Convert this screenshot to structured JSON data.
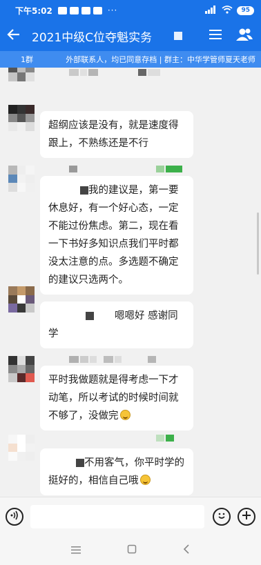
{
  "status_bar": {
    "time": "下午5:02",
    "more": "···",
    "signal": "4G",
    "battery": "95"
  },
  "header": {
    "title": "2021中级C位夺魁实务",
    "back_icon": "arrow-left-icon",
    "menu_icon": "menu-icon",
    "members_icon": "group-members-icon"
  },
  "notice": {
    "left_text": "1群",
    "right_text": "外部联系人，均已同意存档 | 群主：中华学管师夏天老师"
  },
  "messages": [
    {
      "text": "超纲应该是没有，就是速度得跟上，不熟练还是不行"
    },
    {
      "text": "我的建议是，第一要休息好，有一个好心态，一定不能过份焦虑。第二，现在看一下书好多知识点我们平时都没太注意的点。多选题不确定的建议只选两个。"
    },
    {
      "text": "嗯嗯好 感谢同学"
    },
    {
      "text": "平时我做题就是得考虑一下才动笔，所以考试的时候时间就不够了，没做完"
    },
    {
      "text": "不用客气，你平时学的挺好的，相信自己哦"
    }
  ],
  "input_bar": {
    "voice_icon": "voice-icon",
    "emoji_icon": "emoji-icon",
    "plus_icon": "plus-icon",
    "placeholder": ""
  },
  "nav_bar": {
    "menu_icon": "nav-menu-icon",
    "home_icon": "nav-home-icon",
    "back_icon": "nav-back-icon"
  },
  "colors": {
    "header_blue": "#1a73e8",
    "notice_blue": "#3f8cf0",
    "chat_bg": "#f1f1f1"
  }
}
